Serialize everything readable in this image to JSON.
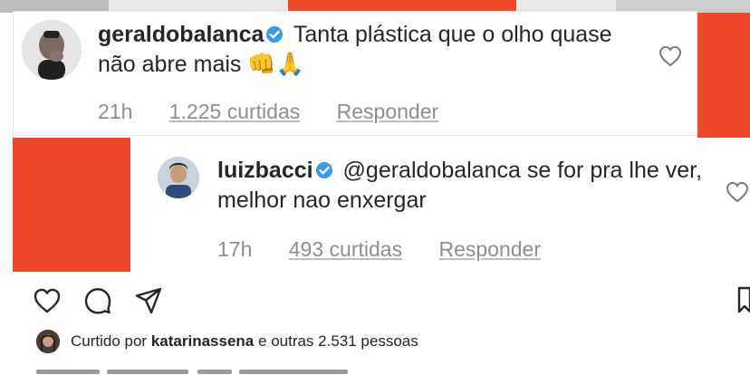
{
  "comments": [
    {
      "username": "geraldobalanca",
      "text": "Tanta plástica que o olho quase não abre mais",
      "emoji": "👊🙏",
      "time": "21h",
      "likes": "1.225 curtidas",
      "reply": "Responder"
    },
    {
      "username": "luizbacci",
      "mention": "@geraldobalanca",
      "text": "se for pra lhe ver, melhor nao enxergar",
      "time": "17h",
      "likes": "493 curtidas",
      "reply": "Responder"
    }
  ],
  "liked_by": {
    "prefix": "Curtido por",
    "user": "katarinassena",
    "middle": "e",
    "others": "outras 2.531 pessoas"
  },
  "icons": [
    "heart-icon",
    "comment-icon",
    "share-icon",
    "bookmark-icon",
    "verified-badge-icon"
  ],
  "colors": {
    "accent_red": "#f04a2d",
    "verified_blue": "#3897f0",
    "meta_gray": "#8e8e8e",
    "text": "#262626"
  }
}
